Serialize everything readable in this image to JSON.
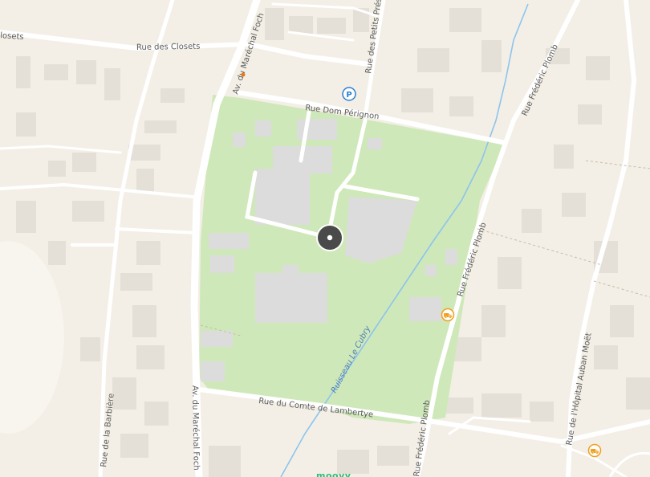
{
  "map": {
    "colors": {
      "land": "#f3efe6",
      "park": "#cfe8b9",
      "building": "#dedad4",
      "building_on_park": "#dcdcdc",
      "road": "#ffffff",
      "water": "#8cc4ee",
      "label": "#5a5a5a",
      "water_label": "#4f7fb7",
      "poi_parking": "#2a7fd4",
      "poi_shop": "#f0a020",
      "marker": "#4a4a4a",
      "brand": "#27c27a"
    },
    "streets": {
      "rue_des_closets": "Rue des Closets",
      "closets_partial": "losets",
      "av_marechal_foch_top": "Av. du Maréchal Foch",
      "av_marechal_foch_bottom": "Av. du Maréchal Foch",
      "rue_des_petits_pres": "Rue des Petits Prés",
      "rue_dom_perignon": "Rue Dom Pérignon",
      "rue_frederic_plomb_top": "Rue Frédéric Plomb",
      "rue_frederic_plomb_mid": "Rue Frédéric Plomb",
      "rue_frederic_plomb_bottom": "Rue Frédéric Plomb",
      "rue_de_la_barbiere": "Rue de la Barbière",
      "rue_du_comte_de_lambertye": "Rue du Comte de Lambertye",
      "rue_hopital_auban_moet": "Rue de l'Hôpital Auban Moët"
    },
    "water_labels": {
      "ruisseau": "Ruisseau Le Cubry"
    },
    "pois": [
      {
        "name": "parking-icon",
        "glyph": "P"
      },
      {
        "name": "shop-icon-1",
        "glyph": "⛟"
      },
      {
        "name": "shop-icon-2",
        "glyph": "⛟"
      }
    ],
    "marker": {
      "name": "location-marker"
    },
    "brand": "moovy"
  }
}
